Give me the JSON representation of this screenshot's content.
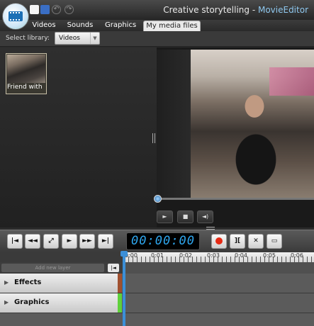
{
  "window": {
    "title_doc": "Creative storytelling - ",
    "title_app": "MovieEditor"
  },
  "quick_actions": {
    "undo": "↶",
    "redo": "↷"
  },
  "tabs": [
    {
      "label": "Videos"
    },
    {
      "label": "Sounds"
    },
    {
      "label": "Graphics"
    },
    {
      "label": "My media files",
      "active": true
    }
  ],
  "library": {
    "label": "Select library:",
    "selected": "Videos",
    "caret": "▼"
  },
  "media_items": [
    {
      "label": "Friend with"
    }
  ],
  "player": {
    "play": "►",
    "stop": "■",
    "volume": "◄)"
  },
  "transport": {
    "start": "|◄",
    "rewind": "◄◄",
    "fullscreen": "⤢",
    "play": "►",
    "fast_forward": "►►",
    "end": "►|",
    "timecode": "00:00:00",
    "split": "][",
    "delete": "✕",
    "caption": "▭"
  },
  "ruler": {
    "labels": [
      "0:00",
      "0:01",
      "0:02",
      "0:03",
      "0:04",
      "0:05",
      "0:06"
    ]
  },
  "timeline": {
    "add_track_label": "Add new layer",
    "track_toggle": "|◄",
    "tracks": [
      {
        "arrow": "▶",
        "label": "Effects",
        "color": "#a0502f"
      },
      {
        "arrow": "▶",
        "label": "Graphics",
        "color": "#5fd13b"
      }
    ]
  },
  "colors": {
    "accent": "#2fa7ef",
    "record": "#e62a14"
  }
}
